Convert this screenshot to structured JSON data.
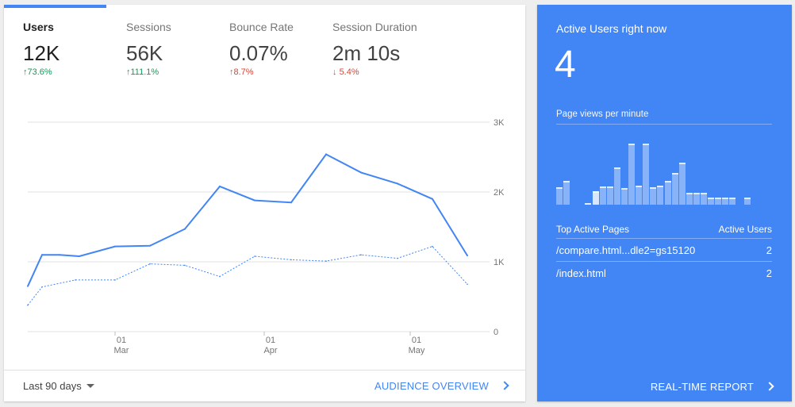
{
  "metrics": [
    {
      "label": "Users",
      "value": "12K",
      "delta": "73.6%",
      "arrow": "↑"
    },
    {
      "label": "Sessions",
      "value": "56K",
      "delta": "111.1%",
      "arrow": "↑"
    },
    {
      "label": "Bounce Rate",
      "value": "0.07%",
      "delta": "8.7%",
      "arrow": "↑"
    },
    {
      "label": "Session Duration",
      "value": "2m 10s",
      "delta": "5.4%",
      "arrow": "↓"
    }
  ],
  "chart_data": {
    "type": "line",
    "y_ticks": [
      "3K",
      "2K",
      "1K",
      "0"
    ],
    "x_ticks": [
      {
        "day": "01",
        "month": "Mar"
      },
      {
        "day": "01",
        "month": "Apr"
      },
      {
        "day": "01",
        "month": "May"
      }
    ],
    "ylim": [
      0,
      3000
    ],
    "series": [
      {
        "values": [
          650,
          1100,
          1100,
          1080,
          1220,
          1230,
          1470,
          2080,
          1880,
          1850,
          2540,
          2280,
          2120,
          1900,
          1090
        ]
      },
      {
        "values": [
          380,
          640,
          740,
          740,
          970,
          950,
          790,
          1080,
          1030,
          1010,
          1100,
          1050,
          1220,
          680
        ]
      }
    ],
    "grid": true,
    "colors": {
      "current": "#4285f4",
      "previous": "#4285f4"
    }
  },
  "footer": {
    "date_range": "Last 90 days",
    "overview_link": "AUDIENCE OVERVIEW"
  },
  "realtime": {
    "title": "Active Users right now",
    "count": "4",
    "pageviews_label": "Page views per minute",
    "bar_levels": [
      0.26,
      0.35,
      0,
      0,
      0.02,
      0.2,
      0.27,
      0.27,
      0.55,
      0.25,
      0.9,
      0.28,
      0.9,
      0.26,
      0.28,
      0.35,
      0.47,
      0.62,
      0.17,
      0.18,
      0.18,
      0.1,
      0.1,
      0.1,
      0.1,
      0,
      0.1
    ],
    "highlight_index": 5,
    "table_headers": [
      "Top Active Pages",
      "Active Users"
    ],
    "rows": [
      {
        "page": "/compare.html...dle2=gs15120",
        "users": "2"
      },
      {
        "page": "/index.html",
        "users": "2"
      }
    ],
    "link": "REAL-TIME REPORT"
  }
}
